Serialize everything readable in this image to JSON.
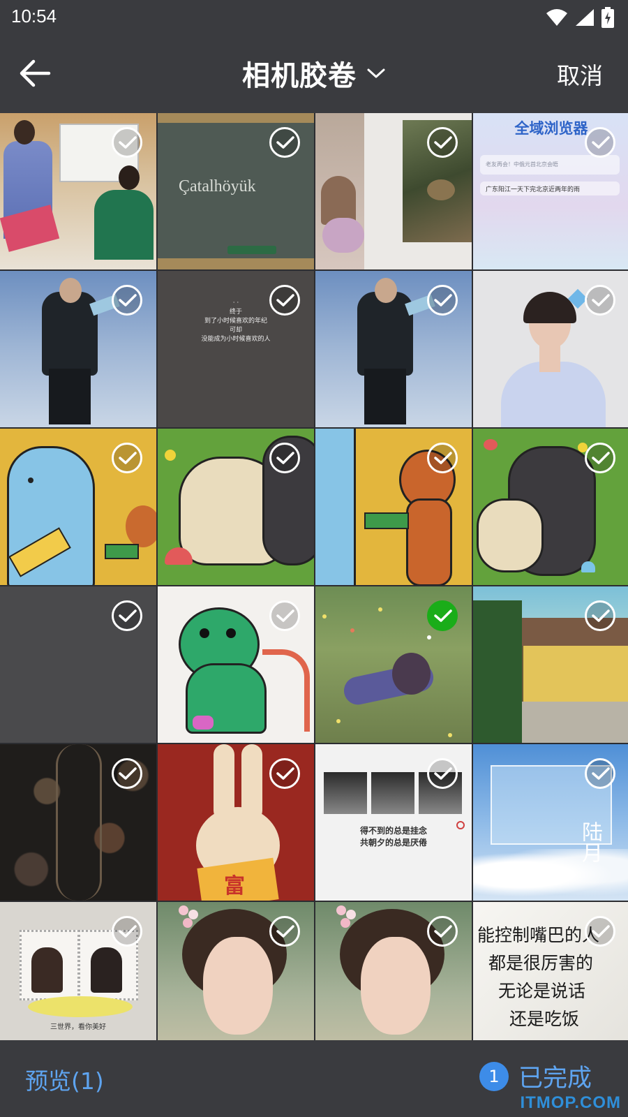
{
  "status_bar": {
    "time": "10:54"
  },
  "header": {
    "title": "相机胶卷",
    "cancel_label": "取消"
  },
  "thumbnails": {
    "catalhoyuk_text": "Çatalhöyük",
    "browser_title": "全域浏览器",
    "browser_line1": "老友再会！中俄元首北京会晤",
    "browser_line2": "广东阳江一天下完北京近两年的雨",
    "quote_lines": [
      "· ·",
      "终于",
      "到了小时候喜欢的年纪",
      "可却",
      "没能成为小时候喜欢的人"
    ],
    "photo_quote_line1": "得不到的总是挂念",
    "photo_quote_line2": "共朝夕的总是厌倦",
    "sky_text": "陆月",
    "stamp_caption": "三世界，看你美好",
    "handwriting_lines": [
      "能控制嘴巴的人",
      "都是很厉害的",
      "无论是说话",
      "还是吃饭"
    ],
    "rabbit_char": "富"
  },
  "selection": {
    "selected_index": 14
  },
  "bottom_bar": {
    "preview_label": "预览(1)",
    "done_count": "1",
    "done_label": "已完成"
  },
  "watermark": "ITMOP.COM"
}
